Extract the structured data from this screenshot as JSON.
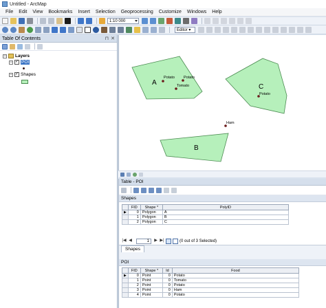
{
  "window": {
    "title": "Untitled - ArcMap"
  },
  "menu": [
    "File",
    "Edit",
    "View",
    "Bookmarks",
    "Insert",
    "Selection",
    "Geoprocessing",
    "Customize",
    "Windows",
    "Help"
  ],
  "toolbar": {
    "scale": "1:10 000",
    "editor_label": "Editor ▾"
  },
  "toc": {
    "title": "Table Of Contents",
    "header_icons": [
      "pin-icon",
      "close-icon"
    ],
    "root_label": "Layers",
    "layers": [
      {
        "name": "POI",
        "checked": true,
        "symbol": "point"
      },
      {
        "name": "Shapes",
        "checked": true,
        "symbol": "polygon"
      }
    ]
  },
  "map": {
    "polygon_fill": "#b6f0bb",
    "polygon_stroke": "#4a8a50",
    "point_color": "#6b1b1b",
    "polygons": [
      {
        "label": "A"
      },
      {
        "label": "B"
      },
      {
        "label": "C"
      }
    ],
    "points": [
      {
        "label": "Potato"
      },
      {
        "label": "Potato"
      },
      {
        "label": "Tomato"
      },
      {
        "label": "Potato"
      },
      {
        "label": "Ham"
      }
    ]
  },
  "table_window": {
    "title": "Table - POI",
    "shapes": {
      "title": "Shapes",
      "columns": [
        "FID",
        "Shape *",
        "PolyID"
      ],
      "rows": [
        [
          "0",
          "Polygon",
          "A"
        ],
        [
          "1",
          "Polygon",
          "B"
        ],
        [
          "2",
          "Polygon",
          "C"
        ]
      ],
      "nav": {
        "record": "1",
        "status": "(0 out of 3 Selected)"
      },
      "tab_label": "Shapes"
    },
    "poi": {
      "title": "POI",
      "columns": [
        "FID",
        "Shape *",
        "Id",
        "Food"
      ],
      "rows": [
        [
          "0",
          "Point",
          "0",
          "Potato"
        ],
        [
          "1",
          "Point",
          "0",
          "Tomato"
        ],
        [
          "2",
          "Point",
          "0",
          "Potato"
        ],
        [
          "3",
          "Point",
          "0",
          "Ham"
        ],
        [
          "4",
          "Point",
          "0",
          "Potato"
        ]
      ]
    }
  }
}
